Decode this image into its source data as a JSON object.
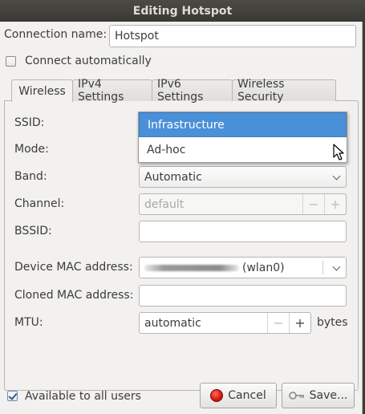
{
  "window": {
    "title": "Editing Hotspot"
  },
  "connection": {
    "name_label": "Connection name:",
    "name_value": "Hotspot"
  },
  "connect_auto": {
    "label": "Connect automatically",
    "checked": false
  },
  "tabs": [
    {
      "label": "Wireless",
      "active": true
    },
    {
      "label": "IPv4 Settings",
      "active": false
    },
    {
      "label": "IPv6 Settings",
      "active": false
    },
    {
      "label": "Wireless Security",
      "active": false
    }
  ],
  "wireless": {
    "ssid_label": "SSID:",
    "mode_label": "Mode:",
    "mode_options": [
      "Infrastructure",
      "Ad-hoc"
    ],
    "mode_highlighted": "Infrastructure",
    "band_label": "Band:",
    "band_value": "Automatic",
    "channel_label": "Channel:",
    "channel_value": "default",
    "bssid_label": "BSSID:",
    "bssid_value": "",
    "device_mac_label": "Device MAC address:",
    "device_mac_suffix": "(wlan0)",
    "cloned_mac_label": "Cloned MAC address:",
    "cloned_mac_value": "",
    "mtu_label": "MTU:",
    "mtu_value": "automatic",
    "mtu_unit": "bytes",
    "minus": "−",
    "plus": "+"
  },
  "footer": {
    "all_users_label": "Available to all users",
    "all_users_checked": true,
    "cancel_label": "Cancel",
    "save_label": "Save..."
  },
  "colors": {
    "selection": "#4a90d9",
    "titlebar": "#3c3b37",
    "window_bg": "#f2f1f0"
  },
  "icons": {
    "cancel": "stop-icon",
    "save": "key-icon",
    "dropdown": "chevron-down-icon"
  }
}
